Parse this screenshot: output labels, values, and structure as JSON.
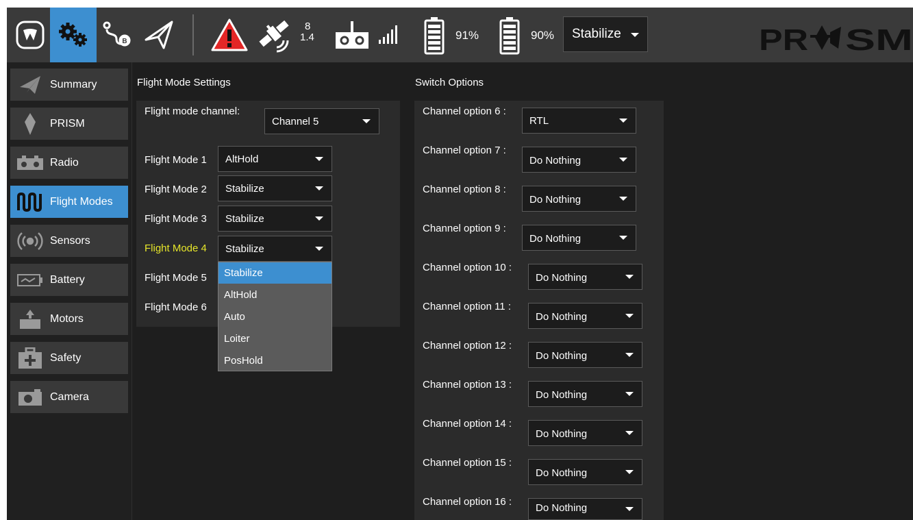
{
  "colors": {
    "accent": "#3d8fd0",
    "warning_fill": "#e32626",
    "highlight_text": "#e6e62a",
    "topbar": "#3a3a3a",
    "background": "#1e1e1e"
  },
  "toolbar": {
    "icons": [
      "app-logo-icon",
      "parameters-gear-icon",
      "plan-route-icon",
      "fly-paper-plane-icon",
      "warning-icon",
      "gps-satellite-icon",
      "rc-transmitter-icon",
      "signal-strength-icon",
      "battery-icon",
      "battery-icon"
    ],
    "gps_satellites": "8",
    "gps_hdop": "1.4",
    "battery1": "91%",
    "battery2": "90%",
    "flight_mode": "Stabilize",
    "brand": "PR SM"
  },
  "sidebar": {
    "items": [
      {
        "label": "Summary",
        "icon": "paper-plane-icon"
      },
      {
        "label": "PRISM",
        "icon": "diamond-icon"
      },
      {
        "label": "Radio",
        "icon": "rc-transmitter-icon"
      },
      {
        "label": "Flight Modes",
        "icon": "wave-icon",
        "active": true
      },
      {
        "label": "Sensors",
        "icon": "broadcast-icon"
      },
      {
        "label": "Battery",
        "icon": "battery-icon"
      },
      {
        "label": "Motors",
        "icon": "motor-icon"
      },
      {
        "label": "Safety",
        "icon": "first-aid-icon"
      },
      {
        "label": "Camera",
        "icon": "camera-icon"
      }
    ]
  },
  "flight_modes": {
    "title": "Flight Mode Settings",
    "channel_label": "Flight mode channel:",
    "channel_value": "Channel 5",
    "modes": [
      {
        "label": "Flight Mode 1",
        "value": "AltHold"
      },
      {
        "label": "Flight Mode 2",
        "value": "Stabilize"
      },
      {
        "label": "Flight Mode 3",
        "value": "Stabilize"
      },
      {
        "label": "Flight Mode 4",
        "value": "Stabilize",
        "highlight": true
      },
      {
        "label": "Flight Mode 5"
      },
      {
        "label": "Flight Mode 6"
      }
    ],
    "dropdown_open": {
      "options": [
        "Stabilize",
        "AltHold",
        "Auto",
        "Loiter",
        "PosHold"
      ],
      "selected": "Stabilize"
    }
  },
  "switch_options": {
    "title": "Switch Options",
    "channels": [
      {
        "label": "Channel option 6 :",
        "value": "RTL"
      },
      {
        "label": "Channel option 7 :",
        "value": "Do Nothing"
      },
      {
        "label": "Channel option 8 :",
        "value": "Do Nothing"
      },
      {
        "label": "Channel option 9 :",
        "value": "Do Nothing"
      },
      {
        "label": "Channel option 10 :",
        "value": "Do Nothing"
      },
      {
        "label": "Channel option 11 :",
        "value": "Do Nothing"
      },
      {
        "label": "Channel option 12 :",
        "value": "Do Nothing"
      },
      {
        "label": "Channel option 13 :",
        "value": "Do Nothing"
      },
      {
        "label": "Channel option 14 :",
        "value": "Do Nothing"
      },
      {
        "label": "Channel option 15 :",
        "value": "Do Nothing"
      },
      {
        "label": "Channel option 16 :",
        "value": "Do Nothing"
      }
    ]
  }
}
